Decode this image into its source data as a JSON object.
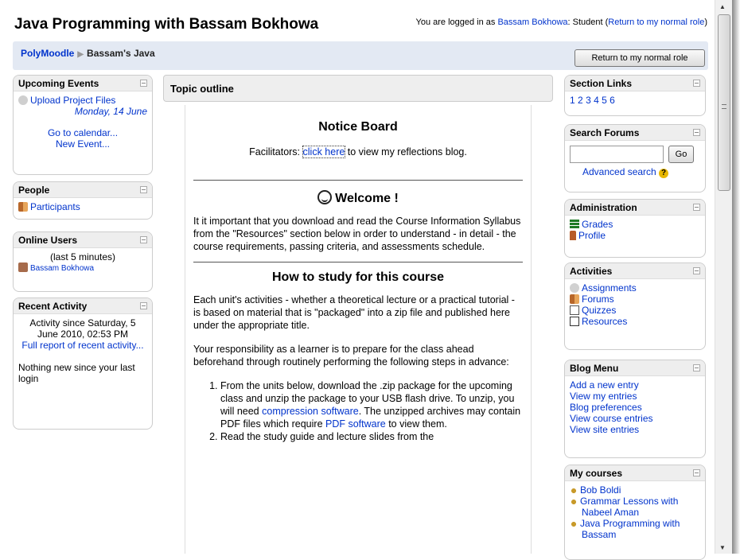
{
  "header": {
    "site_title": "Java Programming with Bassam Bokhowa",
    "login_prefix": "You are logged in as",
    "login_user": "Bassam Bokhowa",
    "login_role": ": Student (",
    "return_link": "Return to my normal role",
    "login_suffix": ")"
  },
  "breadcrumb": {
    "root": "PolyMoodle",
    "current": "Bassam's Java"
  },
  "return_button": "Return to my normal role",
  "left": {
    "upcoming_events": {
      "title": "Upcoming Events",
      "event": "Upload Project Files",
      "date": "Monday, 14 June",
      "calendar": "Go to calendar...",
      "new_event": "New Event..."
    },
    "people": {
      "title": "People",
      "participants": "Participants"
    },
    "online": {
      "title": "Online Users",
      "period": "(last 5 minutes)",
      "user": "Bassam Bokhowa"
    },
    "recent": {
      "title": "Recent Activity",
      "since": "Activity since Saturday, 5 June 2010, 02:53 PM",
      "full_report": "Full report of recent activity...",
      "nothing": "Nothing new since your last login"
    }
  },
  "center": {
    "topic_outline": "Topic outline",
    "notice_title": "Notice Board",
    "facilitators_prefix": "Facilitators: ",
    "click_here": "click here",
    "facilitators_suffix": " to view my reflections blog.",
    "welcome_title": "Welcome !",
    "welcome_text": "It it important that you download and read the Course Information Syllabus from the \"Resources\" section below in order to understand - in detail - the course requirements, passing criteria, and assessments schedule.",
    "study_title": "How to study for this course",
    "study_p1": "Each unit's activities - whether a theoretical lecture or a practical tutorial - is based on material that is \"packaged\" into a zip file and published here under the appropriate title.",
    "study_p2": "Your responsibility as a learner is to prepare for the class ahead beforehand through routinely performing the following steps in advance:",
    "step1_a": "From the units below, download the .zip package for the upcoming class and unzip the package to your USB flash drive. To unzip, you will need ",
    "step1_link1": "compression software",
    "step1_b": ". The unzipped archives may contain PDF files which require ",
    "step1_link2": "PDF software",
    "step1_c": " to view them.",
    "step2": "Read the study guide and lecture slides from the"
  },
  "right": {
    "section_links": {
      "title": "Section Links",
      "links": [
        "1",
        "2",
        "3",
        "4",
        "5",
        "6"
      ]
    },
    "search": {
      "title": "Search Forums",
      "go": "Go",
      "advanced": "Advanced search"
    },
    "admin": {
      "title": "Administration",
      "grades": "Grades",
      "profile": "Profile"
    },
    "activities": {
      "title": "Activities",
      "assignments": "Assignments",
      "forums": "Forums",
      "quizzes": "Quizzes",
      "resources": "Resources"
    },
    "blog": {
      "title": "Blog Menu",
      "items": [
        "Add a new entry",
        "View my entries",
        "Blog preferences",
        "View course entries",
        "View site entries"
      ]
    },
    "courses": {
      "title": "My courses",
      "items": [
        "Bob Boldi",
        "Grammar Lessons with Nabeel Aman",
        "Java Programming with Bassam"
      ]
    }
  }
}
